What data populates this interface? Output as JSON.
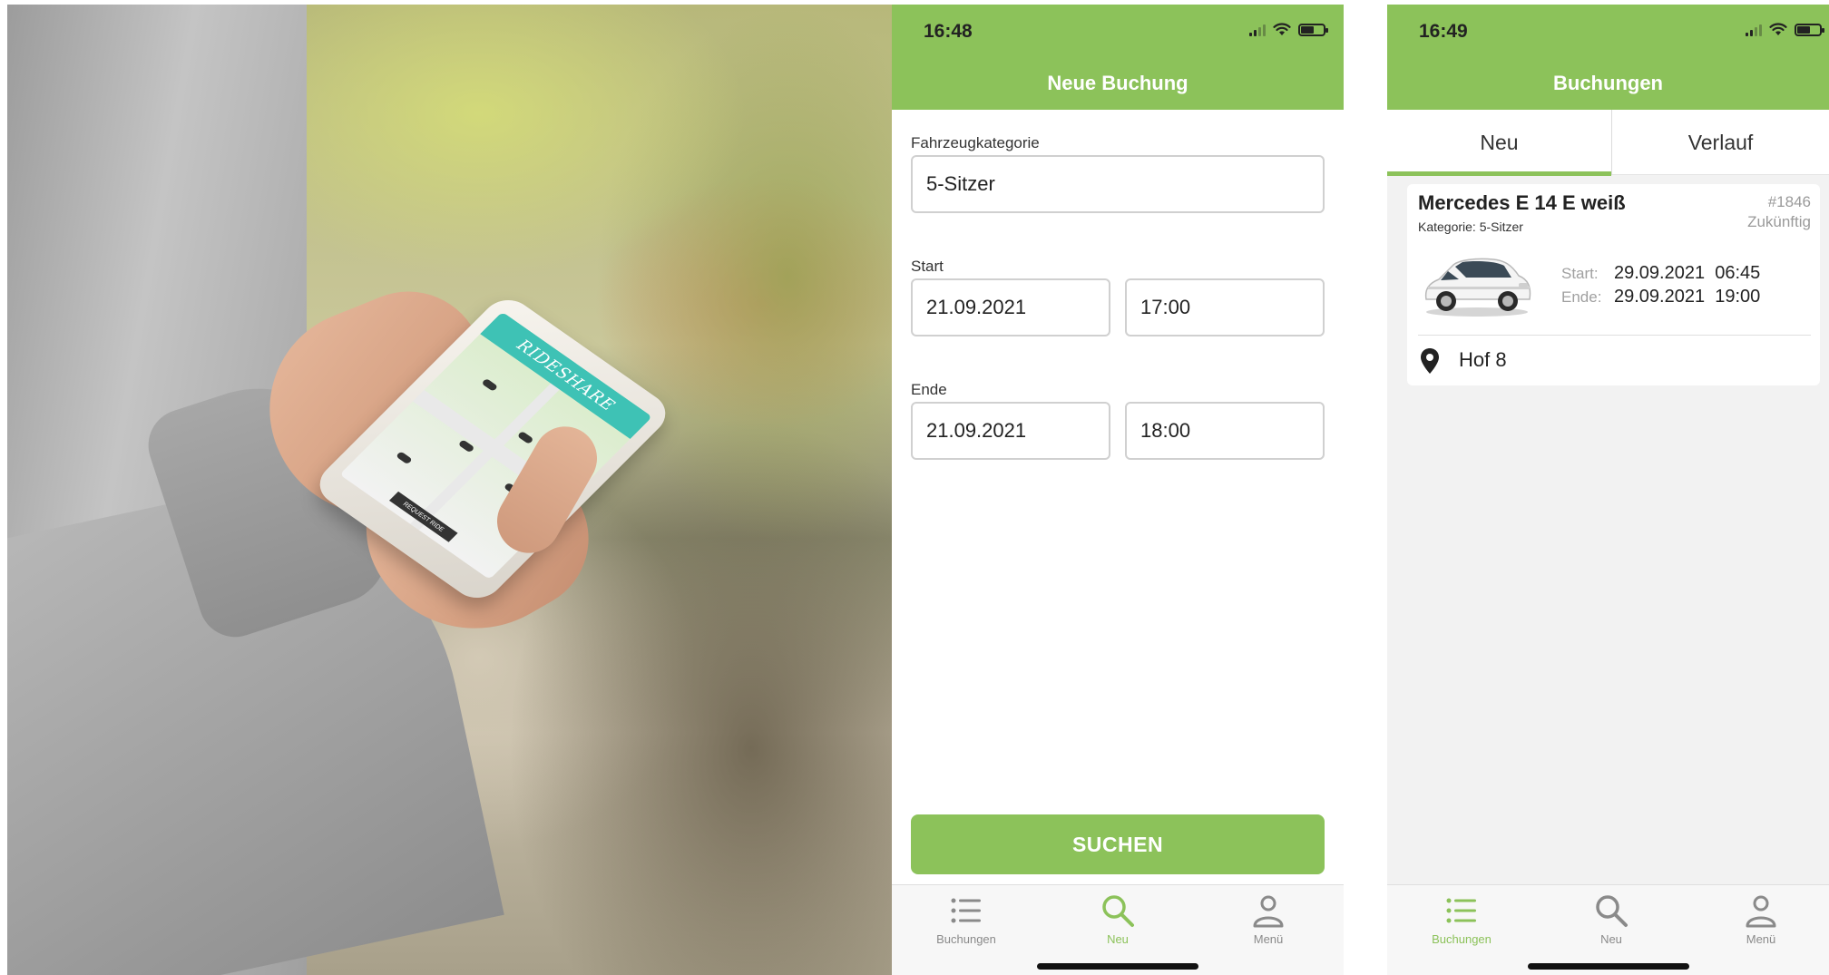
{
  "photo": {
    "phone_app_banner": "RIDESHARE",
    "phone_cta": "REQUEST RIDE"
  },
  "screen_new_booking": {
    "status": {
      "time": "16:48"
    },
    "title": "Neue Buchung",
    "vehicle_category": {
      "label": "Fahrzeugkategorie",
      "value": "5-Sitzer"
    },
    "start": {
      "label": "Start",
      "date": "21.09.2021",
      "time": "17:00"
    },
    "end": {
      "label": "Ende",
      "date": "21.09.2021",
      "time": "18:00"
    },
    "search_button": "SUCHEN",
    "tabbar": [
      {
        "label": "Buchungen",
        "icon": "list-icon",
        "active": false
      },
      {
        "label": "Neu",
        "icon": "search-icon",
        "active": true
      },
      {
        "label": "Menü",
        "icon": "person-icon",
        "active": false
      }
    ]
  },
  "screen_bookings": {
    "status": {
      "time": "16:49"
    },
    "title": "Buchungen",
    "tabs": [
      {
        "label": "Neu",
        "active": true
      },
      {
        "label": "Verlauf",
        "active": false
      }
    ],
    "booking": {
      "vehicle": "Mercedes E 14 E weiß",
      "category": "Kategorie: 5-Sitzer",
      "id": "#1846",
      "status": "Zukünftig",
      "start_label": "Start:",
      "start_value": "29.09.2021  06:45",
      "end_label": "Ende:",
      "end_value": "29.09.2021  19:00",
      "location": "Hof 8"
    },
    "tabbar": [
      {
        "label": "Buchungen",
        "icon": "list-icon",
        "active": true
      },
      {
        "label": "Neu",
        "icon": "search-icon",
        "active": false
      },
      {
        "label": "Menü",
        "icon": "person-icon",
        "active": false
      }
    ]
  },
  "colors": {
    "accent": "#8cc25a",
    "rideshare_teal": "#3ec2b5",
    "muted_text": "#9a9a9a"
  }
}
